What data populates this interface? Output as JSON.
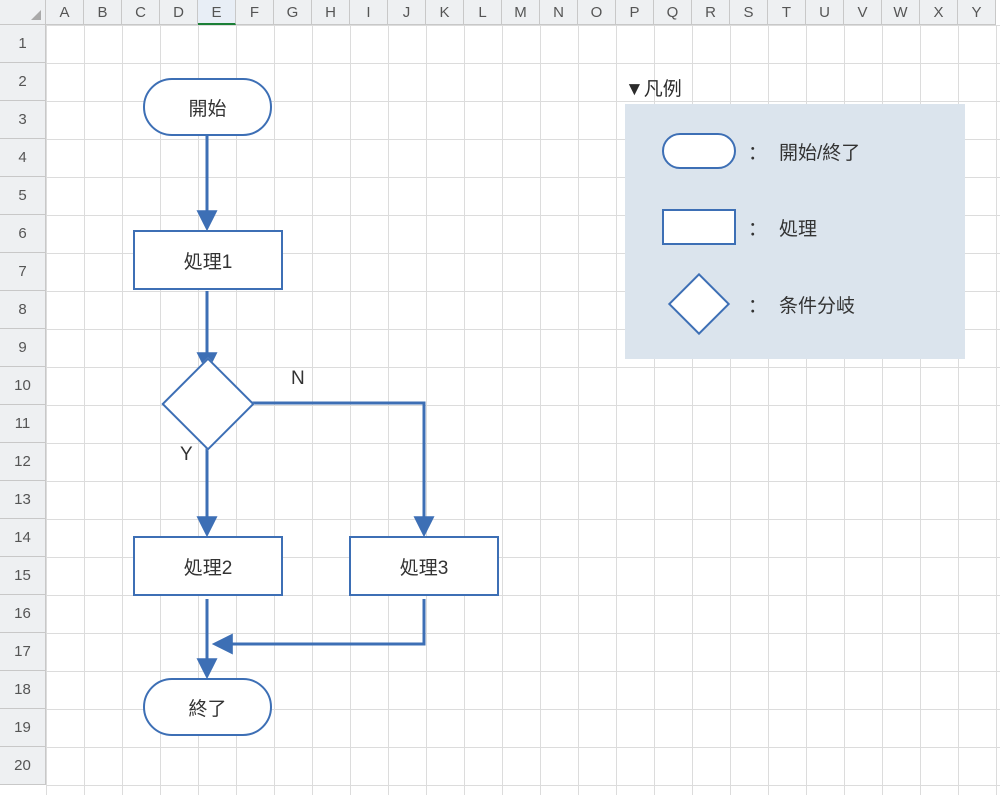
{
  "columns": [
    "A",
    "B",
    "C",
    "D",
    "E",
    "F",
    "G",
    "H",
    "I",
    "J",
    "K",
    "L",
    "M",
    "N",
    "O",
    "P",
    "Q",
    "R",
    "S",
    "T",
    "U",
    "V",
    "W",
    "X",
    "Y"
  ],
  "selected_column": "E",
  "rows": [
    "1",
    "2",
    "3",
    "4",
    "5",
    "6",
    "7",
    "8",
    "9",
    "10",
    "11",
    "12",
    "13",
    "14",
    "15",
    "16",
    "17",
    "18",
    "19",
    "20"
  ],
  "flow": {
    "start": "開始",
    "process1": "処理1",
    "branch_yes": "Y",
    "branch_no": "N",
    "process2": "処理2",
    "process3": "処理3",
    "end": "終了"
  },
  "legend": {
    "title": "▼凡例",
    "sep": "：",
    "terminator": "開始/終了",
    "process": "処理",
    "decision": "条件分岐"
  },
  "colors": {
    "shape_border": "#3d6fb5",
    "legend_bg": "#dbe4ed"
  }
}
